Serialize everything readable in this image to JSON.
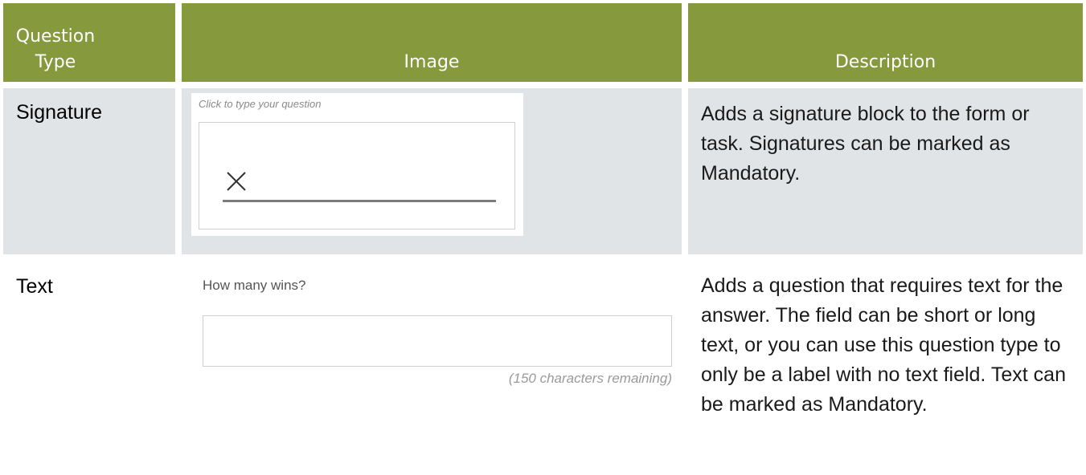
{
  "header": {
    "col1": "Question Type",
    "col2": "Image",
    "col3": "Description"
  },
  "rows": [
    {
      "type": "Signature",
      "image": {
        "prompt": "Click to type your question",
        "mark": "×"
      },
      "description": "Adds a signature block to the form or task. Signatures can be marked as Mandatory."
    },
    {
      "type": "Text",
      "image": {
        "question": "How many wins?",
        "remaining": "(150 characters remaining)"
      },
      "description": "Adds a question that requires text for the answer. The field can be short or long text, or you can use this question type to only be a label with no text field. Text can be marked as Mandatory."
    }
  ],
  "colors": {
    "header_bg": "#86993c",
    "row_shaded_bg": "#e1e4e7"
  }
}
